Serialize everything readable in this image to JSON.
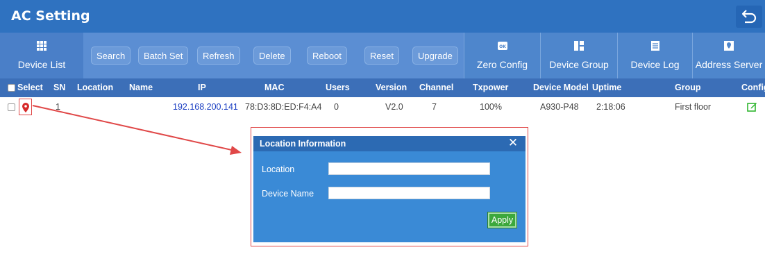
{
  "window": {
    "title": "AC Setting"
  },
  "toolbar": {
    "device_list": "Device List",
    "buttons": [
      "Search",
      "Batch Set",
      "Refresh",
      "Delete",
      "Reboot",
      "Reset",
      "Upgrade"
    ],
    "zero_config": "Zero Config",
    "device_group": "Device Group",
    "device_log": "Device Log",
    "address_server": "Address Server"
  },
  "table": {
    "headers": {
      "select": "Select",
      "sn": "SN",
      "location": "Location",
      "name": "Name",
      "ip": "IP",
      "mac": "MAC",
      "users": "Users",
      "version": "Version",
      "channel": "Channel",
      "txpower": "Txpower",
      "device_model": "Device Model",
      "uptime": "Uptime",
      "group": "Group",
      "config": "Config"
    },
    "rows": [
      {
        "sn": "1",
        "location": "",
        "name": "",
        "ip": "192.168.200.141",
        "mac": "78:D3:8D:ED:F4:A4",
        "users": "0",
        "version": "V2.0",
        "channel": "7",
        "txpower": "100%",
        "device_model": "A930-P48",
        "uptime": "2:18:06",
        "group": "First floor",
        "location_icon": "map-pin-icon",
        "config_icon": "edit-icon"
      }
    ]
  },
  "dialog": {
    "title": "Location Information",
    "close": "✕",
    "location_label": "Location",
    "location_value": "",
    "device_name_label": "Device Name",
    "device_name_value": "",
    "apply_label": "Apply"
  },
  "colors": {
    "title_bar": "#2f72c0",
    "toolbar": "#5b8ed3",
    "table_header": "#3c6fb8",
    "dialog_body": "#3a8ad6",
    "annotation_red": "#e04848",
    "ip_link": "#1a3ec2",
    "apply_green": "#3ca83c"
  }
}
